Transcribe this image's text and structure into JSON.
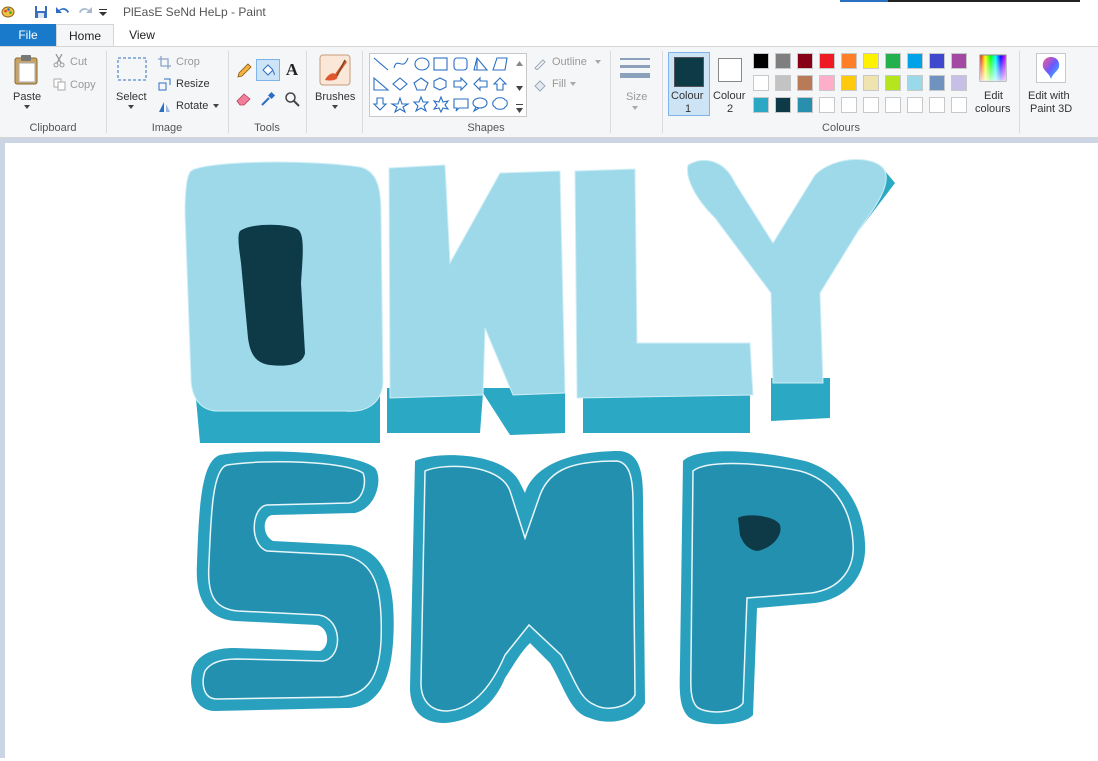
{
  "window": {
    "title": "PlEasE SeNd HeLp - Paint"
  },
  "tabs": {
    "file": "File",
    "home": "Home",
    "view": "View"
  },
  "clipboard": {
    "paste": "Paste",
    "cut": "Cut",
    "copy": "Copy",
    "label": "Clipboard"
  },
  "image": {
    "select": "Select",
    "crop": "Crop",
    "resize": "Resize",
    "rotate": "Rotate",
    "label": "Image"
  },
  "tools": {
    "label": "Tools"
  },
  "brushes": {
    "label": "Brushes"
  },
  "shapes": {
    "outline": "Outline",
    "fill": "Fill",
    "label": "Shapes"
  },
  "size": {
    "label": "Size"
  },
  "colours": {
    "colour1": "Colour 1",
    "colour1_line1": "Colour",
    "colour1_line2": "1",
    "colour2_line1": "Colour",
    "colour2_line2": "2",
    "edit_line1": "Edit",
    "edit_line2": "colours",
    "label": "Colours",
    "colour1_value": "#0e3a47",
    "colour2_value": "#ffffff",
    "palette_row1": [
      "#000000",
      "#7f7f7f",
      "#880015",
      "#ed1c24",
      "#ff7f27",
      "#fff200",
      "#22b14c",
      "#00a2e8",
      "#3f48cc",
      "#a349a4"
    ],
    "palette_row2": [
      "#ffffff",
      "#c3c3c3",
      "#b97a57",
      "#ffaec9",
      "#ffc90e",
      "#efe4b0",
      "#b5e61d",
      "#99d9ea",
      "#7092be",
      "#c8bfe7"
    ],
    "palette_row3": [
      "#2aa8c4",
      "#0e3a47",
      "#2a8fac",
      "#ffffff",
      "#ffffff",
      "#ffffff",
      "#ffffff",
      "#ffffff",
      "#ffffff",
      "#ffffff"
    ]
  },
  "paint3d": {
    "line1": "Edit with",
    "line2": "Paint 3D"
  },
  "artwork": {
    "line1": "ONLY",
    "line2": "SMP",
    "fill_light": "#9ed9ea",
    "shadow": "#2aa8c4",
    "fill_dark": "#2290ae",
    "outline_dark": "#2aa0bf",
    "accent": "#0e3a47"
  }
}
